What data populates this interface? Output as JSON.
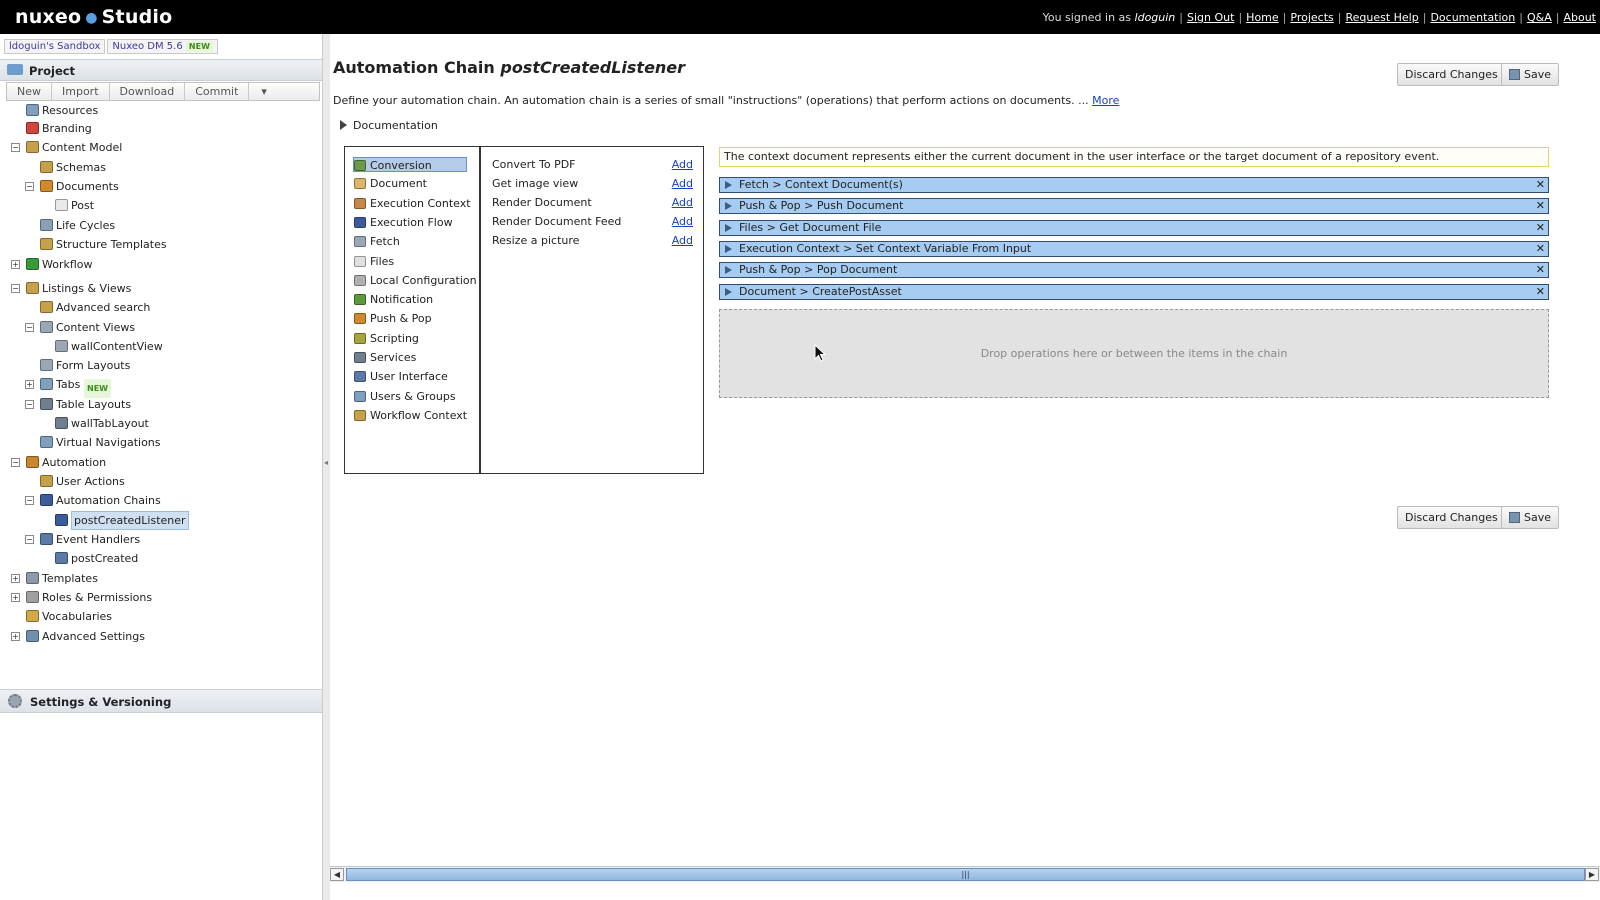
{
  "topbar": {
    "logo_left": "nuxeo",
    "logo_right": "Studio",
    "signed_prefix": "You signed in as",
    "username": "ldoguin",
    "links": [
      "Sign Out",
      "Home",
      "Projects",
      "Request Help",
      "Documentation",
      "Q&A",
      "About"
    ]
  },
  "sandbox": {
    "name": "ldoguin's Sandbox",
    "target": "Nuxeo DM 5.6",
    "badge": "NEW"
  },
  "project": {
    "header": "Project",
    "toolbar": [
      "New",
      "Import",
      "Download",
      "Commit"
    ],
    "tree": [
      {
        "label": "Resources",
        "level": 1,
        "exp": "",
        "icon": "resources-icon",
        "color": "#7f9fbf"
      },
      {
        "label": "Branding",
        "level": 1,
        "exp": "",
        "icon": "branding-icon",
        "color": "#d0463a"
      },
      {
        "label": "Content Model",
        "level": 0,
        "exp": "−",
        "icon": "content-model-icon",
        "color": "#c7a14a"
      },
      {
        "label": "Schemas",
        "level": 2,
        "exp": "",
        "icon": "schemas-icon",
        "color": "#c7a14a"
      },
      {
        "label": "Documents",
        "level": 1,
        "exp": "−",
        "icon": "documents-icon",
        "color": "#d1892d"
      },
      {
        "label": "Post",
        "level": 3,
        "exp": "",
        "icon": "post-icon",
        "color": "#e9e9e9"
      },
      {
        "label": "Life Cycles",
        "level": 2,
        "exp": "",
        "icon": "lifecycles-icon",
        "color": "#8aa0b8"
      },
      {
        "label": "Structure Templates",
        "level": 2,
        "exp": "",
        "icon": "structure-templates-icon",
        "color": "#c7a14a"
      },
      {
        "label": "Workflow",
        "level": 0,
        "exp": "+",
        "icon": "workflow-icon",
        "color": "#3a9a3a"
      },
      {
        "label": "Listings & Views",
        "level": 0,
        "exp": "−",
        "icon": "listings-views-icon",
        "color": "#c7a14a"
      },
      {
        "label": "Advanced search",
        "level": 2,
        "exp": "",
        "icon": "advanced-search-icon",
        "color": "#c7a14a"
      },
      {
        "label": "Content Views",
        "level": 1,
        "exp": "−",
        "icon": "content-views-icon",
        "color": "#9aa8b6"
      },
      {
        "label": "wallContentView",
        "level": 3,
        "exp": "",
        "icon": "content-view-icon",
        "color": "#9aa8b6"
      },
      {
        "label": "Form Layouts",
        "level": 2,
        "exp": "",
        "icon": "form-layouts-icon",
        "color": "#9aa8b6"
      },
      {
        "label": "Tabs",
        "level": 1,
        "exp": "+",
        "icon": "tabs-icon",
        "color": "#7f9fbf",
        "badge": "NEW"
      },
      {
        "label": "Table Layouts",
        "level": 1,
        "exp": "−",
        "icon": "table-layouts-icon",
        "color": "#6f7f8f"
      },
      {
        "label": "wallTabLayout",
        "level": 3,
        "exp": "",
        "icon": "table-layout-icon",
        "color": "#6f7f8f"
      },
      {
        "label": "Virtual Navigations",
        "level": 2,
        "exp": "",
        "icon": "virtual-navigations-icon",
        "color": "#7f9fbf"
      },
      {
        "label": "Automation",
        "level": 0,
        "exp": "−",
        "icon": "automation-icon",
        "color": "#c9852f"
      },
      {
        "label": "User Actions",
        "level": 2,
        "exp": "",
        "icon": "user-actions-icon",
        "color": "#c7a14a"
      },
      {
        "label": "Automation Chains",
        "level": 1,
        "exp": "−",
        "icon": "automation-chains-icon",
        "color": "#3b5b9a"
      },
      {
        "label": "postCreatedListener",
        "level": 3,
        "exp": "",
        "icon": "chain-icon",
        "color": "#3b5b9a",
        "selected": true
      },
      {
        "label": "Event Handlers",
        "level": 1,
        "exp": "−",
        "icon": "event-handlers-icon",
        "color": "#5a7aa8"
      },
      {
        "label": "postCreated",
        "level": 3,
        "exp": "",
        "icon": "event-handler-icon",
        "color": "#5a7aa8"
      },
      {
        "label": "Templates",
        "level": 0,
        "exp": "+",
        "icon": "templates-icon",
        "color": "#8a9aaa"
      },
      {
        "label": "Roles & Permissions",
        "level": 0,
        "exp": "+",
        "icon": "roles-permissions-icon",
        "color": "#a0a0a0"
      },
      {
        "label": "Vocabularies",
        "level": 1,
        "exp": "",
        "icon": "vocabularies-icon",
        "color": "#d1a84a"
      },
      {
        "label": "Advanced Settings",
        "level": 0,
        "exp": "+",
        "icon": "advanced-settings-icon",
        "color": "#6f8faf"
      }
    ],
    "settings": "Settings & Versioning"
  },
  "main": {
    "title_prefix": "Automation Chain",
    "title_name": "postCreatedListener",
    "description": "Define your automation chain. An automation chain is a series of small \"instructions\" (operations) that perform actions on documents. ...",
    "more_link": "More",
    "documentation_toggle": "Documentation",
    "discard_label": "Discard Changes",
    "save_label": "Save",
    "categories": [
      {
        "label": "Conversion",
        "icon": "conversion-icon",
        "color": "#6a9a4a",
        "selected": true
      },
      {
        "label": "Document",
        "icon": "document-icon",
        "color": "#d9b56a"
      },
      {
        "label": "Execution Context",
        "icon": "execution-context-icon",
        "color": "#c7894a"
      },
      {
        "label": "Execution Flow",
        "icon": "execution-flow-icon",
        "color": "#3b5b9a"
      },
      {
        "label": "Fetch",
        "icon": "fetch-icon",
        "color": "#9aa8b6"
      },
      {
        "label": "Files",
        "icon": "files-icon",
        "color": "#e0e0e0"
      },
      {
        "label": "Local Configuration",
        "icon": "local-configuration-icon",
        "color": "#b0b0b0"
      },
      {
        "label": "Notification",
        "icon": "notification-icon",
        "color": "#5a9a3a"
      },
      {
        "label": "Push & Pop",
        "icon": "push-pop-icon",
        "color": "#d1892d"
      },
      {
        "label": "Scripting",
        "icon": "scripting-icon",
        "color": "#a6a63a"
      },
      {
        "label": "Services",
        "icon": "services-icon",
        "color": "#6f7f8f"
      },
      {
        "label": "User Interface",
        "icon": "user-interface-icon",
        "color": "#5a7aa8"
      },
      {
        "label": "Users & Groups",
        "icon": "users-groups-icon",
        "color": "#7f9fbf"
      },
      {
        "label": "Workflow Context",
        "icon": "workflow-context-icon",
        "color": "#c7a14a"
      }
    ],
    "operations": [
      {
        "label": "Convert To PDF",
        "action": "Add"
      },
      {
        "label": "Get image view",
        "action": "Add"
      },
      {
        "label": "Render Document",
        "action": "Add"
      },
      {
        "label": "Render Document Feed",
        "action": "Add"
      },
      {
        "label": "Resize a picture",
        "action": "Add"
      }
    ],
    "context_note": "The context document represents either the current document in the user interface or the target document of a repository event.",
    "chain": [
      "Fetch > Context Document(s)",
      "Push & Pop > Push Document",
      "Files > Get Document File",
      "Execution Context > Set Context Variable From Input",
      "Push & Pop > Pop Document",
      "Document > CreatePostAsset"
    ],
    "remove_glyph": "✕",
    "dropzone": "Drop operations here or between the items in the chain"
  },
  "colors": {
    "topbar_bg": "#000000",
    "chain_step_bg": "#a6ccf2",
    "link": "#1a3fbf"
  }
}
